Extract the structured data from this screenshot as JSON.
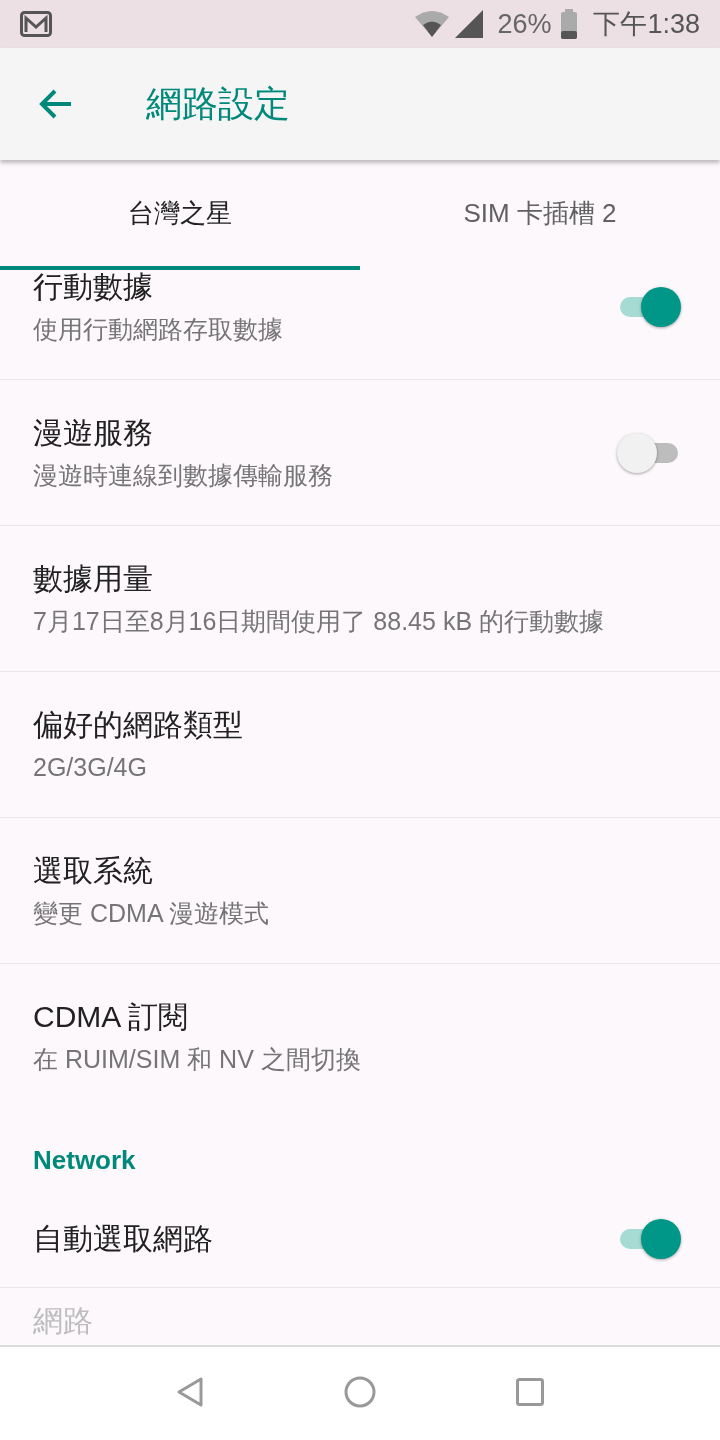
{
  "status_bar": {
    "battery": "26%",
    "time": "下午1:38"
  },
  "app_bar": {
    "title": "網路設定"
  },
  "tabs": [
    {
      "label": "台灣之星",
      "selected": true
    },
    {
      "label": "SIM 卡插槽 2",
      "selected": false
    }
  ],
  "items": [
    {
      "kind": "toggle",
      "title": "行動數據",
      "summary": "使用行動網路存取數據",
      "on": true
    },
    {
      "kind": "toggle",
      "title": "漫遊服務",
      "summary": "漫遊時連線到數據傳輸服務",
      "on": false
    },
    {
      "kind": "text",
      "title": "數據用量",
      "summary": "7月17日至8月16日期間使用了 88.45 kB 的行動數據",
      "disabled": false
    },
    {
      "kind": "text",
      "title": "偏好的網路類型",
      "summary": "2G/3G/4G",
      "disabled": false
    },
    {
      "kind": "text",
      "title": "選取系統",
      "summary": "變更 CDMA 漫遊模式",
      "disabled": false
    },
    {
      "kind": "text",
      "title": "CDMA 訂閱",
      "summary": "在 RUIM/SIM 和 NV 之間切換",
      "disabled": false
    },
    {
      "kind": "header",
      "title": "Network"
    },
    {
      "kind": "toggle",
      "title": "自動選取網路",
      "on": true
    },
    {
      "kind": "text",
      "title": "網路",
      "disabled": true
    }
  ]
}
